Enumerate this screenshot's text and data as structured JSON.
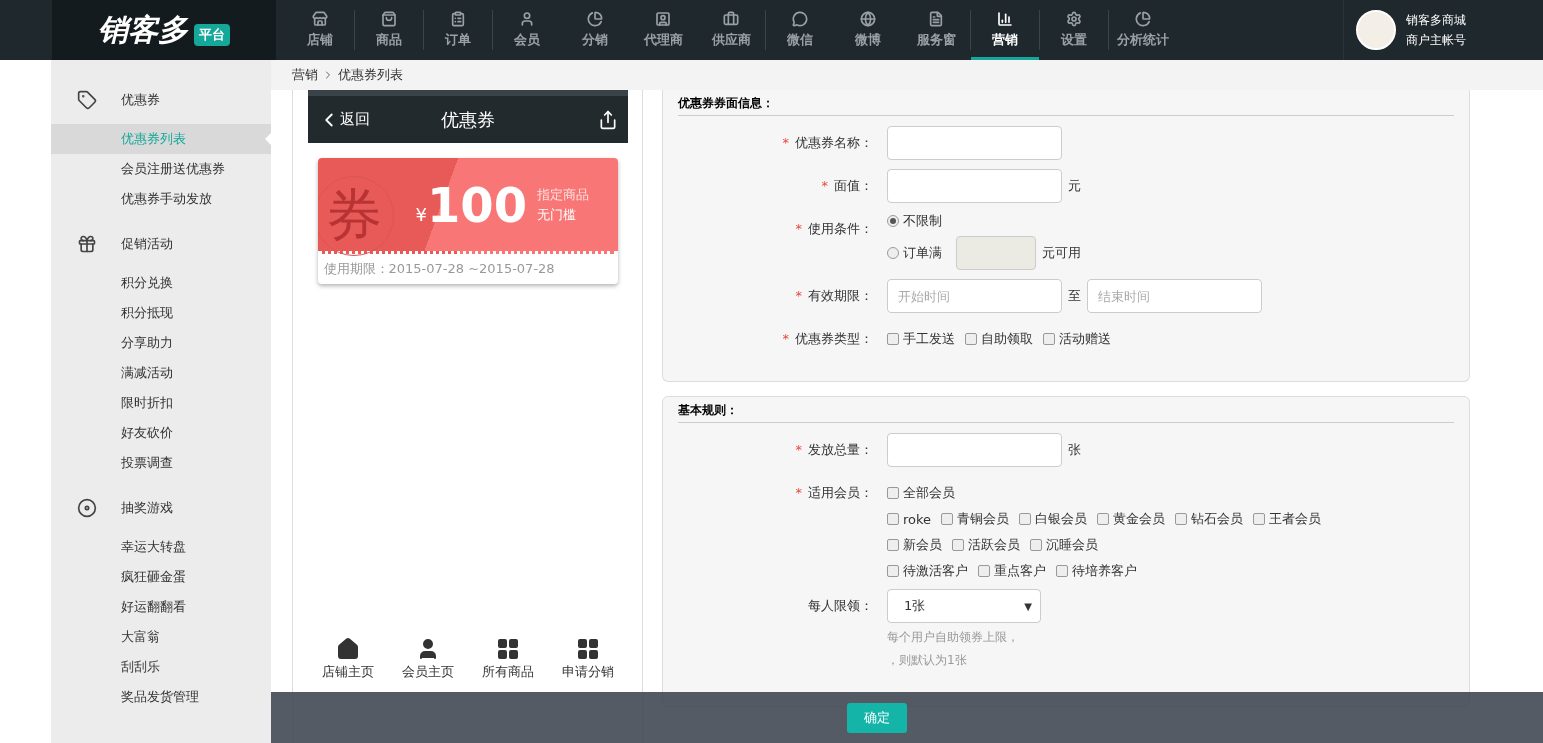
{
  "header": {
    "logo": "销客多",
    "logo_badge": "平台",
    "nav_groups": [
      [
        {
          "label": "店铺",
          "selected": false
        }
      ],
      [
        {
          "label": "商品",
          "selected": false
        }
      ],
      [
        {
          "label": "订单",
          "selected": false
        }
      ],
      [
        {
          "label": "会员",
          "selected": false
        },
        {
          "label": "分销",
          "selected": false
        },
        {
          "label": "代理商",
          "selected": false
        },
        {
          "label": "供应商",
          "selected": false
        }
      ],
      [
        {
          "label": "微信",
          "selected": false
        },
        {
          "label": "微博",
          "selected": false
        },
        {
          "label": "服务窗",
          "selected": false
        }
      ],
      [
        {
          "label": "营销",
          "selected": true
        }
      ],
      [
        {
          "label": "设置",
          "selected": false
        }
      ],
      [
        {
          "label": "分析统计",
          "selected": false
        }
      ]
    ],
    "account": {
      "name": "销客多商城",
      "role": "商户主帐号"
    }
  },
  "sidebar": [
    {
      "title": "优惠券",
      "items": [
        {
          "label": "优惠券列表",
          "selected": true
        },
        {
          "label": "会员注册送优惠券",
          "selected": false
        },
        {
          "label": "优惠券手动发放",
          "selected": false
        }
      ]
    },
    {
      "title": "促销活动",
      "items": [
        {
          "label": "积分兑换",
          "selected": false
        },
        {
          "label": "积分抵现",
          "selected": false
        },
        {
          "label": "分享助力",
          "selected": false
        },
        {
          "label": "满减活动",
          "selected": false
        },
        {
          "label": "限时折扣",
          "selected": false
        },
        {
          "label": "好友砍价",
          "selected": false
        },
        {
          "label": "投票调查",
          "selected": false
        }
      ]
    },
    {
      "title": "抽奖游戏",
      "items": [
        {
          "label": "幸运大转盘",
          "selected": false
        },
        {
          "label": "疯狂砸金蛋",
          "selected": false
        },
        {
          "label": "好运翻翻看",
          "selected": false
        },
        {
          "label": "大富翁",
          "selected": false
        },
        {
          "label": "刮刮乐",
          "selected": false
        },
        {
          "label": "奖品发货管理",
          "selected": false
        }
      ]
    }
  ],
  "breadcrumb": [
    "营销",
    "优惠券列表"
  ],
  "preview": {
    "back": "返回",
    "title": "优惠券",
    "coupon": {
      "watermark": "券",
      "currency": "¥",
      "amount": "100",
      "scope": "指定商品",
      "condition": "无门槛",
      "validity": "使用期限：2015-07-28 ~2015-07-28"
    },
    "bottom_nav": [
      "店铺主页",
      "会员主页",
      "所有商品",
      "申请分销"
    ]
  },
  "form": [
    {
      "title": "优惠券券面信息：",
      "fields": [
        {
          "kind": "text",
          "label": "优惠券名称：",
          "required": true
        },
        {
          "kind": "text",
          "label": "面值：",
          "required": true,
          "suffix": "元"
        },
        {
          "kind": "radio",
          "label": "使用条件：",
          "required": true,
          "options": [
            {
              "label": "不限制",
              "selected": true
            },
            {
              "label": "订单满",
              "selected": false,
              "suffix": "元可用"
            }
          ]
        },
        {
          "kind": "daterange",
          "label": "有效期限：",
          "required": true,
          "start_placeholder": "开始时间",
          "separator": "至",
          "end_placeholder": "结束时间"
        },
        {
          "kind": "checks",
          "label": "优惠券类型：",
          "required": true,
          "rows": [
            [
              {
                "label": "手工发送",
                "checked": false
              },
              {
                "label": "自助领取",
                "checked": false
              },
              {
                "label": "活动赠送",
                "checked": false
              }
            ]
          ]
        }
      ]
    },
    {
      "title": "基本规则：",
      "fields": [
        {
          "kind": "text",
          "label": "发放总量：",
          "required": true,
          "suffix": "张"
        },
        {
          "kind": "checks",
          "label": "适用会员：",
          "required": true,
          "rows": [
            [
              {
                "label": "全部会员",
                "checked": false
              }
            ],
            [
              {
                "label": "roke",
                "checked": false
              },
              {
                "label": "青铜会员",
                "checked": false
              },
              {
                "label": "白银会员",
                "checked": false
              },
              {
                "label": "黄金会员",
                "checked": false
              },
              {
                "label": "钻石会员",
                "checked": false
              },
              {
                "label": "王者会员",
                "checked": false
              }
            ],
            [
              {
                "label": "新会员",
                "checked": false
              },
              {
                "label": "活跃会员",
                "checked": false
              },
              {
                "label": "沉睡会员",
                "checked": false
              }
            ],
            [
              {
                "label": "待激活客户",
                "checked": false
              },
              {
                "label": "重点客户",
                "checked": false
              },
              {
                "label": "待培养客户",
                "checked": false
              }
            ]
          ]
        },
        {
          "kind": "select",
          "label": "每人限领：",
          "required": false,
          "value": "1张",
          "caret": "▼",
          "hints": [
            "每个用户自助领券上限，",
            "，则默认为1张"
          ]
        }
      ]
    }
  ],
  "required_mark": "*",
  "confirm": "确定"
}
